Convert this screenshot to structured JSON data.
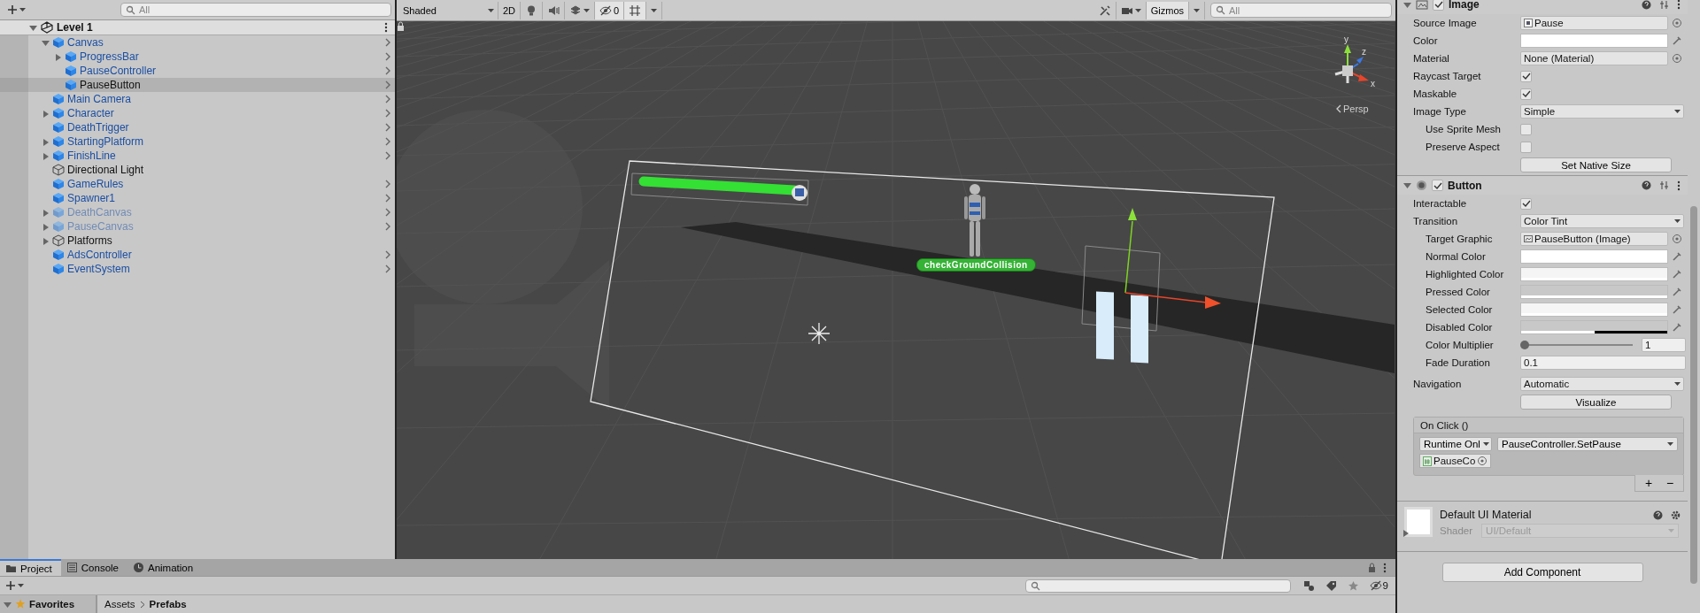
{
  "hierarchy": {
    "search": {
      "placeholder": "All"
    },
    "scene": {
      "name": "Level 1",
      "expanded": true
    },
    "items": [
      {
        "name": "Canvas",
        "kind": "prefab",
        "active": true,
        "selected": false,
        "expanded": true,
        "children": [
          {
            "name": "ProgressBar",
            "kind": "prefab",
            "active": true,
            "selected": false,
            "expanded": false
          },
          {
            "name": "PauseController",
            "kind": "prefab",
            "active": true,
            "selected": false
          },
          {
            "name": "PauseButton",
            "kind": "prefab",
            "active": true,
            "selected": true
          }
        ]
      },
      {
        "name": "Main Camera",
        "kind": "prefab",
        "active": true,
        "selected": false
      },
      {
        "name": "Character",
        "kind": "prefab",
        "active": true,
        "selected": false,
        "expanded": false
      },
      {
        "name": "DeathTrigger",
        "kind": "prefab",
        "active": true,
        "selected": false
      },
      {
        "name": "StartingPlatform",
        "kind": "prefab",
        "active": true,
        "selected": false,
        "expanded": false
      },
      {
        "name": "FinishLine",
        "kind": "prefab",
        "active": true,
        "selected": false,
        "expanded": false
      },
      {
        "name": "Directional Light",
        "kind": "object",
        "active": true,
        "selected": false
      },
      {
        "name": "GameRules",
        "kind": "prefab",
        "active": true,
        "selected": false
      },
      {
        "name": "Spawner1",
        "kind": "prefab",
        "active": true,
        "selected": false
      },
      {
        "name": "DeathCanvas",
        "kind": "prefab",
        "active": false,
        "selected": false,
        "expanded": false
      },
      {
        "name": "PauseCanvas",
        "kind": "prefab",
        "active": false,
        "selected": false,
        "expanded": false
      },
      {
        "name": "Platforms",
        "kind": "object",
        "active": true,
        "selected": false,
        "expanded": false
      },
      {
        "name": "AdsController",
        "kind": "prefab",
        "active": true,
        "selected": false
      },
      {
        "name": "EventSystem",
        "kind": "prefab",
        "active": true,
        "selected": false
      }
    ]
  },
  "scene_toolbar": {
    "shading": "Shaded",
    "mode_2d": "2D",
    "hidden_count": "0",
    "gizmos": "Gizmos",
    "search": {
      "placeholder": "All"
    }
  },
  "scene": {
    "axis_labels": [
      "y",
      "z",
      "x"
    ],
    "projection": "Persp",
    "collision_label": "checkGroundCollision"
  },
  "inspector": {
    "components": [
      {
        "kind": "image",
        "title": "Image",
        "enabled": true,
        "fields": [
          {
            "label": "Source Image",
            "kind": "object",
            "value": {
              "kind": "sprite",
              "text": "Pause"
            }
          },
          {
            "label": "Color",
            "kind": "color",
            "color": "#ffffff",
            "level": 1
          },
          {
            "label": "Material",
            "kind": "object",
            "value": {
              "kind": "none",
              "text": "None (Material)"
            }
          },
          {
            "label": "Raycast Target",
            "kind": "checkbox",
            "checked": true
          },
          {
            "label": "Maskable",
            "kind": "checkbox",
            "checked": true
          },
          {
            "label": "Image Type",
            "kind": "dropdown",
            "value": "Simple",
            "children": [
              {
                "label": "Use Sprite Mesh",
                "kind": "checkbox",
                "checked": false
              },
              {
                "label": "Preserve Aspect",
                "kind": "checkbox",
                "checked": false
              }
            ]
          }
        ],
        "action_button": "Set Native Size"
      },
      {
        "kind": "button",
        "title": "Button",
        "enabled": true,
        "fields": [
          {
            "label": "Interactable",
            "kind": "checkbox",
            "checked": true
          },
          {
            "label": "Transition",
            "kind": "dropdown",
            "value": "Color Tint",
            "children": [
              {
                "label": "Target Graphic",
                "kind": "object",
                "value": {
                  "kind": "image",
                  "text": "PauseButton (Image)"
                }
              },
              {
                "label": "Normal Color",
                "kind": "color",
                "color": "#ffffff",
                "level": 1
              },
              {
                "label": "Highlighted Color",
                "kind": "color",
                "color": "#f5f5f5",
                "level": 1
              },
              {
                "label": "Pressed Color",
                "kind": "color",
                "color": "#c8c8c8",
                "level": 1
              },
              {
                "label": "Selected Color",
                "kind": "color",
                "color": "#f5f5f5",
                "level": 1
              },
              {
                "label": "Disabled Color",
                "kind": "color",
                "color": "#c8c8c8",
                "level": 0.5
              },
              {
                "label": "Color Multiplier",
                "kind": "slider",
                "level": 0,
                "reading": "1"
              },
              {
                "label": "Fade Duration",
                "kind": "number",
                "value": "0.1"
              }
            ]
          }
        ],
        "navigation": {
          "label": "Navigation",
          "value": "Automatic"
        },
        "action_button": "Visualize",
        "on_click": {
          "title": "On Click ()",
          "call_state": "Runtime Onl",
          "function": "PauseController.SetPause",
          "target": "PauseCo",
          "add": "+",
          "remove": "−"
        }
      }
    ],
    "material": {
      "name": "Default UI Material",
      "shader_label": "Shader",
      "shader": "UI/Default"
    },
    "add_component": "Add Component"
  },
  "bottom": {
    "tabs": [
      {
        "label": "Project",
        "kind": "project",
        "selected": true
      },
      {
        "label": "Console",
        "kind": "console",
        "selected": false
      },
      {
        "label": "Animation",
        "kind": "animation",
        "selected": false
      }
    ],
    "hidden_count": "9",
    "favorites": "Favorites",
    "breadcrumb": [
      "Assets",
      "Prefabs"
    ]
  }
}
